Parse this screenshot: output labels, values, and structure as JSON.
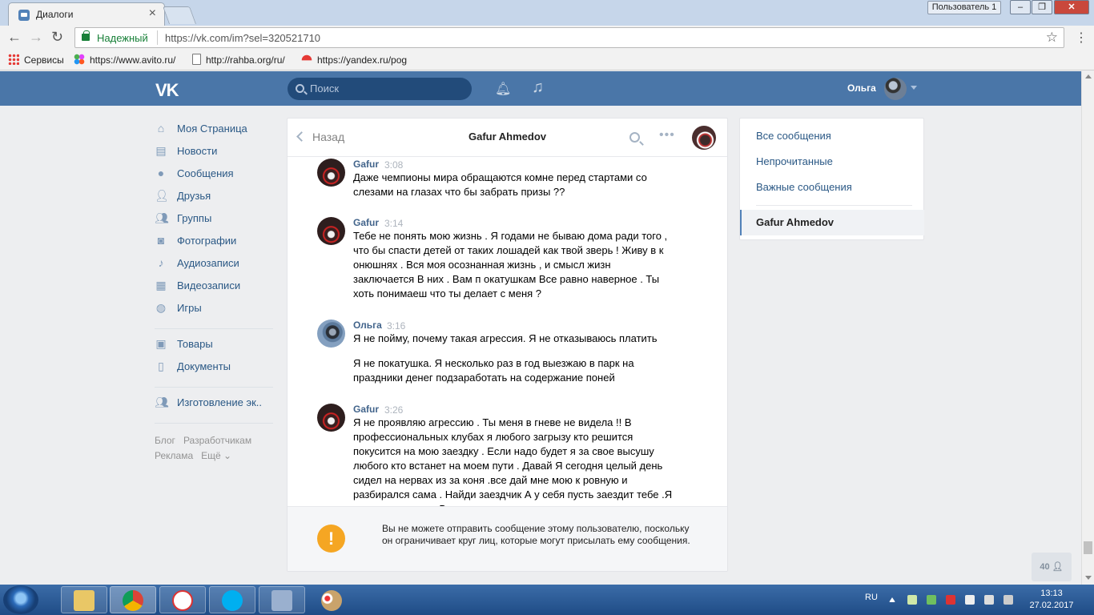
{
  "browser": {
    "tab_title": "Диалоги",
    "tab_close": "×",
    "profile_label": "Пользователь 1",
    "win_min": "–",
    "win_max": "❐",
    "win_close": "✕",
    "secure_label": "Надежный",
    "url": "https://vk.com/im?sel=320521710",
    "bookmarks": [
      {
        "label": "Сервисы",
        "icon": "apps-icon"
      },
      {
        "label": "https://www.avito.ru/",
        "icon": "avito-icon"
      },
      {
        "label": "http://rahba.org/ru/",
        "icon": "page-icon"
      },
      {
        "label": "https://yandex.ru/pog",
        "icon": "umbrella-icon"
      }
    ]
  },
  "header": {
    "logo": "VK",
    "search_placeholder": "Поиск",
    "user_name": "Ольга"
  },
  "left_menu": {
    "items": [
      {
        "label": "Моя Страница",
        "icon": "home-icon"
      },
      {
        "label": "Новости",
        "icon": "news-icon"
      },
      {
        "label": "Сообщения",
        "icon": "messages-icon"
      },
      {
        "label": "Друзья",
        "icon": "friends-icon"
      },
      {
        "label": "Группы",
        "icon": "groups-icon"
      },
      {
        "label": "Фотографии",
        "icon": "camera-icon"
      },
      {
        "label": "Аудиозаписи",
        "icon": "music-icon"
      },
      {
        "label": "Видеозаписи",
        "icon": "video-icon"
      },
      {
        "label": "Игры",
        "icon": "gamepad-icon"
      }
    ],
    "items2": [
      {
        "label": "Товары",
        "icon": "bag-icon"
      },
      {
        "label": "Документы",
        "icon": "document-icon"
      }
    ],
    "items3": [
      {
        "label": "Изготовление эк..",
        "icon": "group-icon"
      }
    ],
    "footer": {
      "blog": "Блог",
      "developers": "Разработчикам",
      "ads": "Реклама",
      "more": "Ещё ⌄"
    }
  },
  "chat": {
    "back_label": "Назад",
    "title": "Gafur Ahmedov",
    "more_label": "•••",
    "messages": [
      {
        "author": "Gafur",
        "time": "3:08",
        "text": [
          "Даже чемпионы мира обращаются комне перед стартами со слезами на глазах что бы забрать призы ??"
        ]
      },
      {
        "author": "Gafur",
        "time": "3:14",
        "text": [
          "Тебе не понять мою жизнь . Я годами не бываю дома ради того , что бы спасти детей от таких лошадей как твой зверь ! Живу в к онюшнях . Вся моя осознанная жизнь , и смысл жизн заключается В них . Вам п окатушкам Все равно наверное . Ты хоть понимаеш что ты делает с меня ?"
        ]
      },
      {
        "author": "Ольга",
        "time": "3:16",
        "text": [
          "Я не пойму, почему такая агрессия. Я не отказываюсь платить",
          "Я не покатушка. Я несколько раз в год выезжаю в парк на праздники денег подзаработать на содержание поней"
        ]
      },
      {
        "author": "Gafur",
        "time": "3:26",
        "text": [
          "Я не проявляю агрессию . Ты меня в гневе не видела !! В профессиональных клубах я любого загрызу кто решится покусится на мою заездку . Если надо будет я за свое высушу любого кто встанет на моем пути . Давай Я сегодня целый день сидел на нервах из за коня .все дай мне мою к ровную и разбирался сама . Найди заездчик А у себя пусть заездит тебе .Я теперь не полезу В твои дела"
        ]
      }
    ],
    "notice": "Вы не можете отправить сообщение этому пользователю, поскольку он ограничивает круг лиц, которые могут присылать ему сообщения.",
    "notice_icon": "!"
  },
  "right_menu": {
    "all": "Все сообщения",
    "unread": "Непрочитанные",
    "important": "Важные сообщения",
    "active": "Gafur Ahmedov"
  },
  "online_count": "40",
  "taskbar": {
    "lang": "RU",
    "time": "13:13",
    "date": "27.02.2017"
  }
}
